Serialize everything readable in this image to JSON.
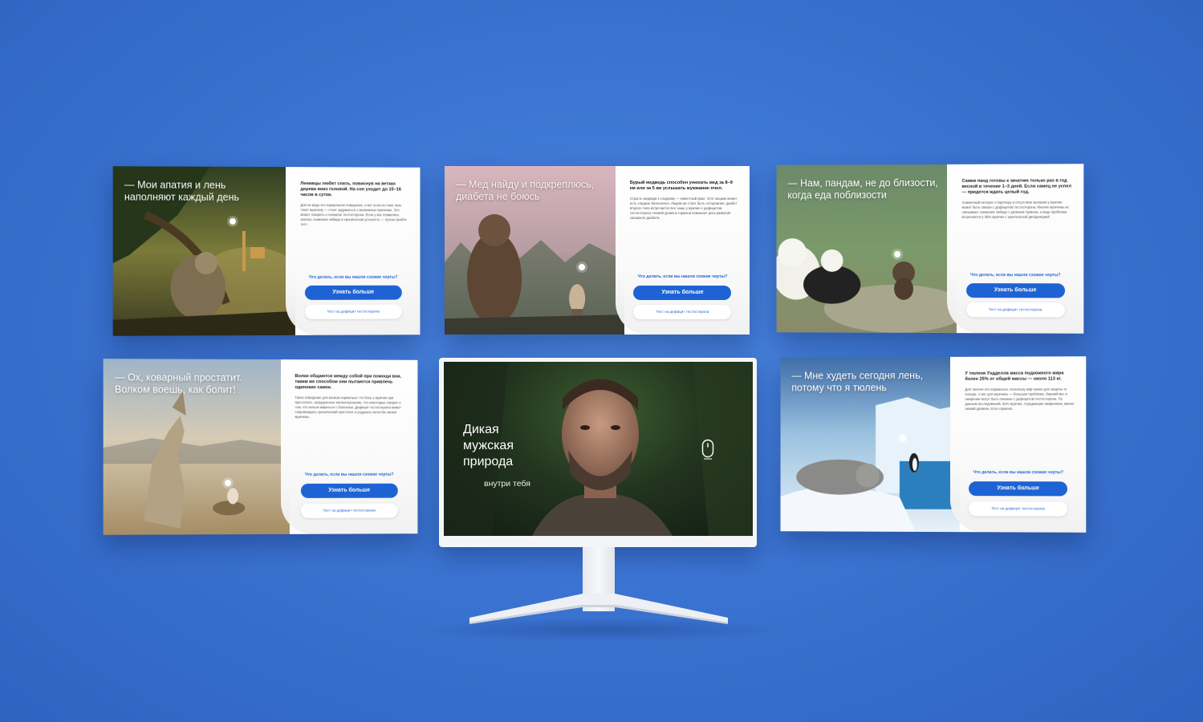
{
  "slides": [
    {
      "headline": "— Мои апатия и лень\nнаполняют каждый день",
      "bold": "Ленивцы любят спать, повиснув на ветках дерева вниз головой. На сон уходит до 15–16 часов в сутки.",
      "body": "Для их вида это нормальное поведение, а вот если на тоже лень тянет мужчину — стоит задуматься о возможных причинах. Это может говорить о нехватке тестостерона. Если у вас появились апатия, снижение либидо и хроническая усталость — лучше пройти тест.",
      "question": "Что делать, если вы нашли схожие черты?",
      "primary": "Узнать больше",
      "secondary": "Тест на дефицит тестостерона"
    },
    {
      "headline": "— Мед найду и подкреплюсь,\nдиабета не боюсь",
      "bold": "Бурый медведь способен унюхать мед за 8–9 км или за 5 км услышать жужжание пчел.",
      "body": "Страсть медведя к сладкому — известный факт. Этот хищник может есть сладкое бесконечно. Людям же стоит быть осторожнее: диабет второго типа встречается все чаще у мужчин с дефицитом тестостерона. Низкий уровень гормона повышает риск развития сахарного диабета.",
      "question": "Что делать, если вы нашли схожие черты?",
      "primary": "Узнать больше",
      "secondary": "Тест на дефицит тестостерона"
    },
    {
      "headline": "— Нам, пандам, не до близости,\nкогда еда поблизости",
      "bold": "Самки панд готовы к зачатию только раз в год весной в течение 1–3 дней. Если самец не успел — придется ждать целый год.",
      "body": "Сниженный интерес к партнеру и отсутствие желания у мужчин может быть связан с дефицитом тестостерона. Многие мужчины не связывают снижение либидо с уровнем гормона, а ведь проблема встречается у 38% мужчин с эректильной дисфункцией.",
      "question": "Что делать, если вы нашли схожие черты?",
      "primary": "Узнать больше",
      "secondary": "Тест на дефицит тестостерона"
    },
    {
      "headline": "— Ох, коварный простатит.\nВолком воешь, как болит!",
      "bold": "Волки общаются между собой при помощи воя, таким же способом они пытаются привлечь одиноких самок.",
      "body": "Такое поведение для волков нормально. Но боль у мужчин при простатите, затрудненное мочеиспускание, что некоторые говорят о том, что нельзя мириться с болезнью. Дефицит тестостерона может сопровождать хронический простатит и ухудшать качество жизни мужчины.",
      "question": "Что делать, если вы нашли схожие черты?",
      "primary": "Узнать больше",
      "secondary": "Тест на дефицит тестостерона"
    },
    {
      "headline": "— Мне худеть сегодня лень,\nпотому что я тюлень",
      "bold": "У тюленя Уэдделла масса подкожного жира более 25% от общей массы — около 113 кг.",
      "body": "Для тюленя это нормально, поскольку жир нужен для защиты от холода. А вот для мужчины — большая проблема. Лишний вес и ожирение могут быть связаны с дефицитом тестостерона. По данным исследований, 52% мужчин, страдающих ожирением, имеют низкий уровень этого гормона.",
      "question": "Что делать, если вы нашли схожие черты?",
      "primary": "Узнать больше",
      "secondary": "Тест на дефицит тестостерона"
    }
  ],
  "hero": {
    "title_line1": "Дикая",
    "title_line2": "мужская",
    "title_line3": "природа",
    "subtitle": "внутри тебя"
  }
}
